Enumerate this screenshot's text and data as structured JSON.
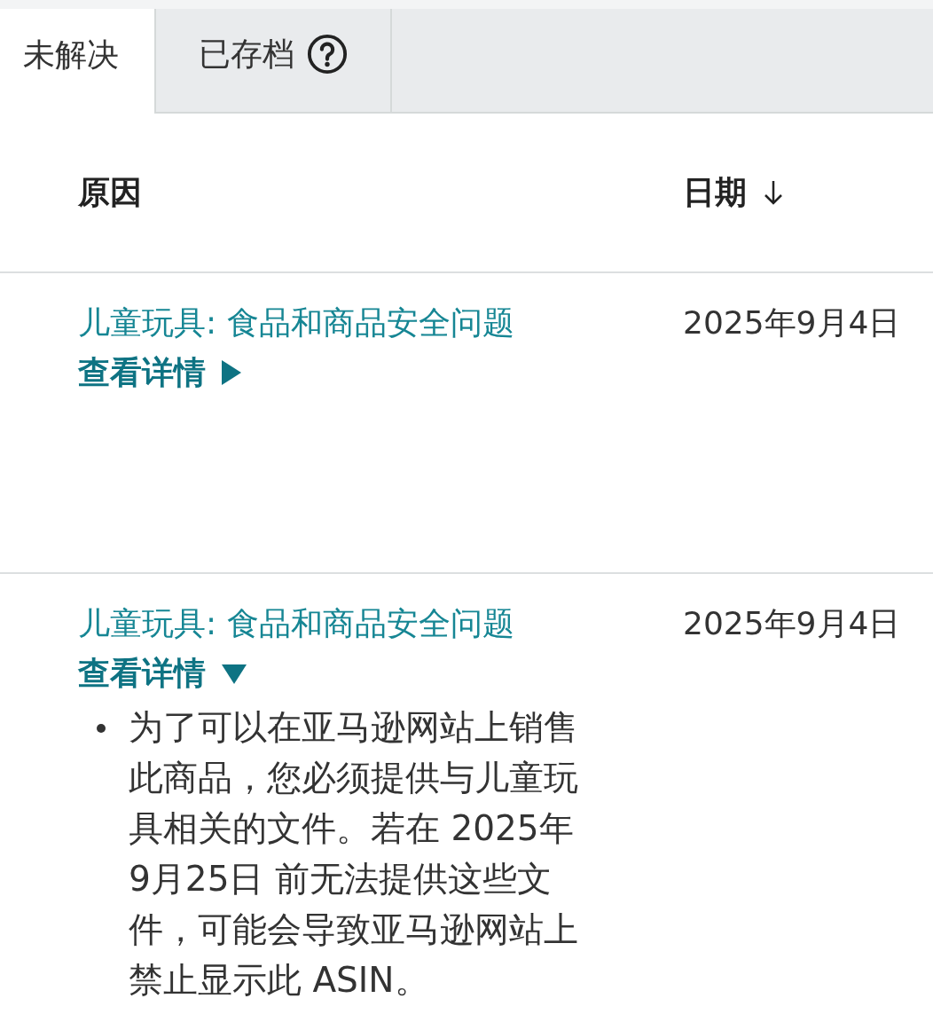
{
  "tabs": [
    {
      "label": "未解决",
      "selected": true,
      "help": false
    },
    {
      "label": "已存档",
      "selected": false,
      "help": true
    }
  ],
  "table": {
    "columns": [
      {
        "label": "原因",
        "sorted": false
      },
      {
        "label": "日期",
        "sorted": true
      }
    ],
    "rows": [
      {
        "reason": "儿童玩具: 食品和商品安全问题",
        "link": "查看详情",
        "expanded": false,
        "date": "2025年9月4日",
        "details": []
      },
      {
        "reason": "儿童玩具: 食品和商品安全问题",
        "link": "查看详情",
        "expanded": true,
        "date": "2025年9月4日",
        "details": [
          "为了可以在亚马逊网站上销售此商品，您必须提供与儿童玩具相关的文件。若在 2025年9月25日 前无法提供这些文件，可能会导致亚马逊网站上禁止显示此 ASIN。"
        ]
      }
    ]
  }
}
